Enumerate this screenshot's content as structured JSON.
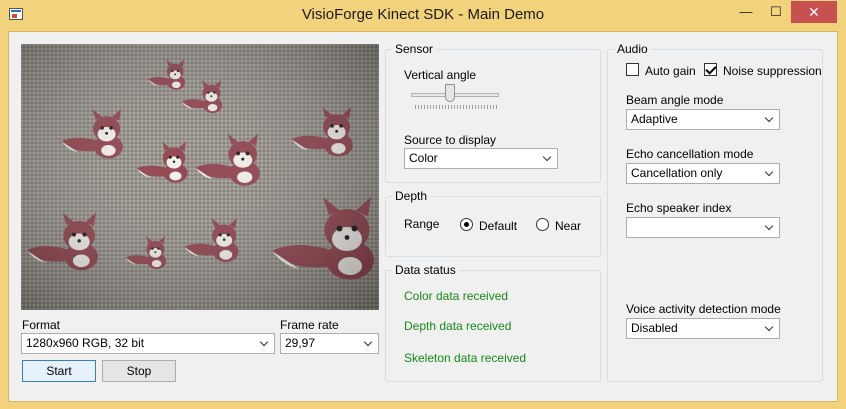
{
  "window": {
    "title": "VisioForge Kinect SDK - Main Demo",
    "minimize_glyph": "—",
    "maximize_glyph": "☐",
    "close_glyph": "✕"
  },
  "left": {
    "format_label": "Format",
    "format_value": "1280x960 RGB, 32 bit",
    "frame_rate_label": "Frame rate",
    "frame_rate_value": "29,97",
    "start_label": "Start",
    "stop_label": "Stop"
  },
  "sensor": {
    "group_title": "Sensor",
    "vertical_angle_label": "Vertical angle",
    "vertical_angle_level": 0.5,
    "source_label": "Source to display",
    "source_value": "Color"
  },
  "depth": {
    "group_title": "Depth",
    "range_label": "Range",
    "options": [
      {
        "label": "Default",
        "selected": true
      },
      {
        "label": "Near",
        "selected": false
      }
    ]
  },
  "data_status": {
    "group_title": "Data status",
    "items": [
      "Color data received",
      "Depth data received",
      "Skeleton data received"
    ],
    "color": "#168a16"
  },
  "audio": {
    "group_title": "Audio",
    "auto_gain": {
      "label": "Auto gain",
      "checked": false
    },
    "noise_suppression": {
      "label": "Noise suppression",
      "checked": true
    },
    "beam_angle_label": "Beam angle mode",
    "beam_angle_value": "Adaptive",
    "echo_mode_label": "Echo cancellation mode",
    "echo_mode_value": "Cancellation only",
    "echo_speaker_label": "Echo speaker index",
    "echo_speaker_value": "",
    "vad_label": "Voice activity detection mode",
    "vad_value": "Disabled"
  }
}
